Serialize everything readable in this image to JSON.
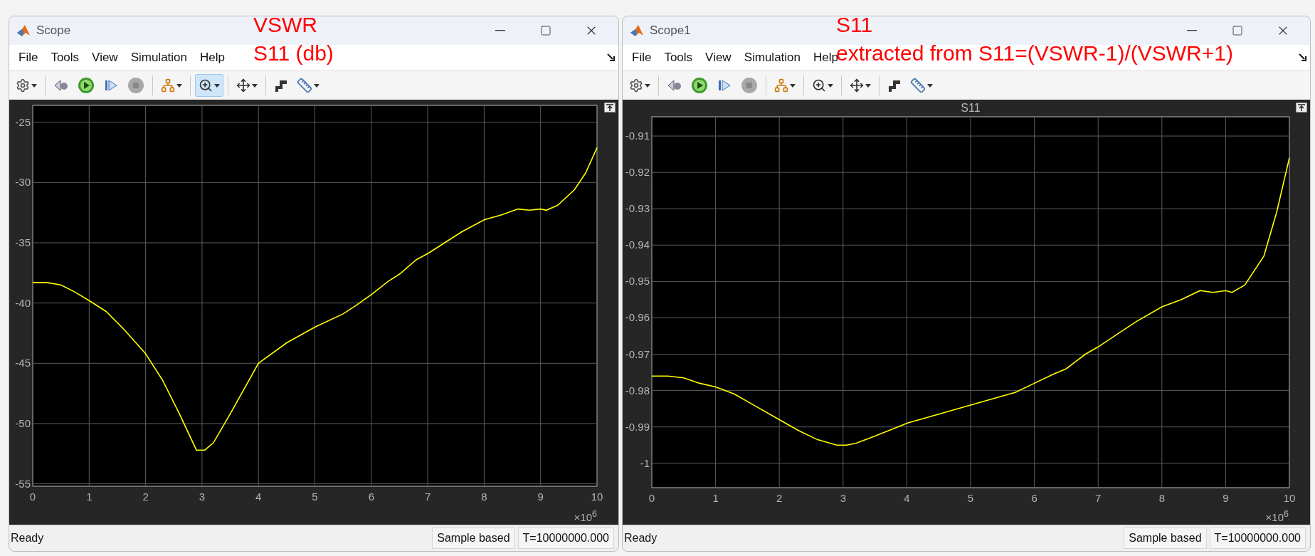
{
  "windows": [
    {
      "title": "Scope",
      "menu": [
        "File",
        "Tools",
        "View",
        "Simulation",
        "Help"
      ],
      "toolbar": [
        {
          "kind": "settings",
          "has_menu": true,
          "selected": false
        },
        {
          "kind": "separator"
        },
        {
          "kind": "step-back",
          "has_menu": false,
          "selected": false
        },
        {
          "kind": "run",
          "has_menu": false,
          "selected": false
        },
        {
          "kind": "step-forward",
          "has_menu": false,
          "selected": false
        },
        {
          "kind": "stop",
          "has_menu": false,
          "selected": false
        },
        {
          "kind": "separator"
        },
        {
          "kind": "signals",
          "has_menu": true,
          "selected": false
        },
        {
          "kind": "separator"
        },
        {
          "kind": "zoom",
          "has_menu": true,
          "selected": true
        },
        {
          "kind": "separator"
        },
        {
          "kind": "fit",
          "has_menu": true,
          "selected": false
        },
        {
          "kind": "separator"
        },
        {
          "kind": "triggers",
          "has_menu": false,
          "selected": false
        },
        {
          "kind": "measure",
          "has_menu": true,
          "selected": false
        }
      ],
      "note": [
        "VSWR",
        "S11 (db)"
      ],
      "plot": {
        "x_exponent": "×10$^{6}$",
        "chart_data": {
          "type": "line",
          "x": [
            0,
            0.25,
            0.5,
            0.75,
            1,
            1.3,
            1.6,
            2,
            2.3,
            2.6,
            2.9,
            3.05,
            3.2,
            3.5,
            4,
            4.5,
            5,
            5.5,
            5.7,
            6,
            6.3,
            6.5,
            6.8,
            7,
            7.3,
            7.6,
            8,
            8.3,
            8.6,
            8.8,
            9,
            9.1,
            9.3,
            9.6,
            9.8,
            10
          ],
          "grid": true,
          "series": [
            {
              "color": "#ffff00",
              "values": [
                -38.3,
                -38.3,
                -38.5,
                -39.1,
                -39.8,
                -40.7,
                -42.1,
                -44.2,
                -46.4,
                -49.2,
                -52.2,
                -52.2,
                -51.6,
                -49.2,
                -45,
                -43.3,
                -42,
                -40.9,
                -40.3,
                -39.3,
                -38.2,
                -37.6,
                -36.4,
                -35.9,
                -35.0,
                -34.1,
                -33.1,
                -32.7,
                -32.2,
                -32.3,
                -32.2,
                -32.3,
                -31.9,
                -30.6,
                -29.2,
                -27.1
              ]
            }
          ],
          "xlim": [
            0,
            10
          ],
          "ylim": [
            -55.2,
            -23.6
          ],
          "xticks": [
            0,
            1,
            2,
            3,
            4,
            5,
            6,
            7,
            8,
            9,
            10
          ],
          "yticks": [
            -55,
            -50,
            -45,
            -40,
            -35,
            -30,
            -25
          ]
        }
      },
      "status": {
        "message": "Ready",
        "mode": "Sample based",
        "time": "T=10000000.000"
      }
    },
    {
      "title": "Scope1",
      "menu": [
        "File",
        "Tools",
        "View",
        "Simulation",
        "Help"
      ],
      "toolbar": [
        {
          "kind": "settings",
          "has_menu": true,
          "selected": false
        },
        {
          "kind": "separator"
        },
        {
          "kind": "step-back",
          "has_menu": false,
          "selected": false
        },
        {
          "kind": "run",
          "has_menu": false,
          "selected": false
        },
        {
          "kind": "step-forward",
          "has_menu": false,
          "selected": false
        },
        {
          "kind": "stop",
          "has_menu": false,
          "selected": false
        },
        {
          "kind": "separator"
        },
        {
          "kind": "signals",
          "has_menu": true,
          "selected": false
        },
        {
          "kind": "separator"
        },
        {
          "kind": "zoom",
          "has_menu": true,
          "selected": false
        },
        {
          "kind": "separator"
        },
        {
          "kind": "fit",
          "has_menu": true,
          "selected": false
        },
        {
          "kind": "separator"
        },
        {
          "kind": "triggers",
          "has_menu": false,
          "selected": false
        },
        {
          "kind": "measure",
          "has_menu": true,
          "selected": false
        }
      ],
      "note": [
        "S11",
        "extracted from S11=(VSWR-1)/(VSWR+1)"
      ],
      "plot": {
        "x_exponent": "×10$^{6}$",
        "chart_data": {
          "type": "line",
          "title": "S11",
          "x": [
            0,
            0.25,
            0.5,
            0.75,
            1,
            1.3,
            1.6,
            2,
            2.3,
            2.6,
            2.9,
            3.05,
            3.2,
            3.5,
            4,
            4.5,
            5,
            5.5,
            5.7,
            6,
            6.3,
            6.5,
            6.8,
            7,
            7.3,
            7.6,
            8,
            8.3,
            8.6,
            8.8,
            9,
            9.1,
            9.3,
            9.6,
            9.8,
            10
          ],
          "grid": true,
          "series": [
            {
              "color": "#ffff00",
              "values": [
                -0.976,
                -0.976,
                -0.9765,
                -0.978,
                -0.979,
                -0.981,
                -0.984,
                -0.988,
                -0.991,
                -0.9935,
                -0.995,
                -0.995,
                -0.9945,
                -0.9925,
                -0.989,
                -0.9865,
                -0.984,
                -0.9815,
                -0.9805,
                -0.978,
                -0.9755,
                -0.974,
                -0.97,
                -0.968,
                -0.9645,
                -0.961,
                -0.957,
                -0.955,
                -0.9525,
                -0.953,
                -0.9525,
                -0.953,
                -0.951,
                -0.943,
                -0.931,
                -0.916
              ]
            }
          ],
          "xlim": [
            0,
            10
          ],
          "ylim": [
            -1.0067,
            -0.9047
          ],
          "xticks": [
            0,
            1,
            2,
            3,
            4,
            5,
            6,
            7,
            8,
            9,
            10
          ],
          "yticks": [
            -1,
            -0.99,
            -0.98,
            -0.97,
            -0.96,
            -0.95,
            -0.94,
            -0.93,
            -0.92,
            -0.91
          ]
        }
      },
      "status": {
        "message": "Ready",
        "mode": "Sample based",
        "time": "T=10000000.000"
      }
    }
  ]
}
